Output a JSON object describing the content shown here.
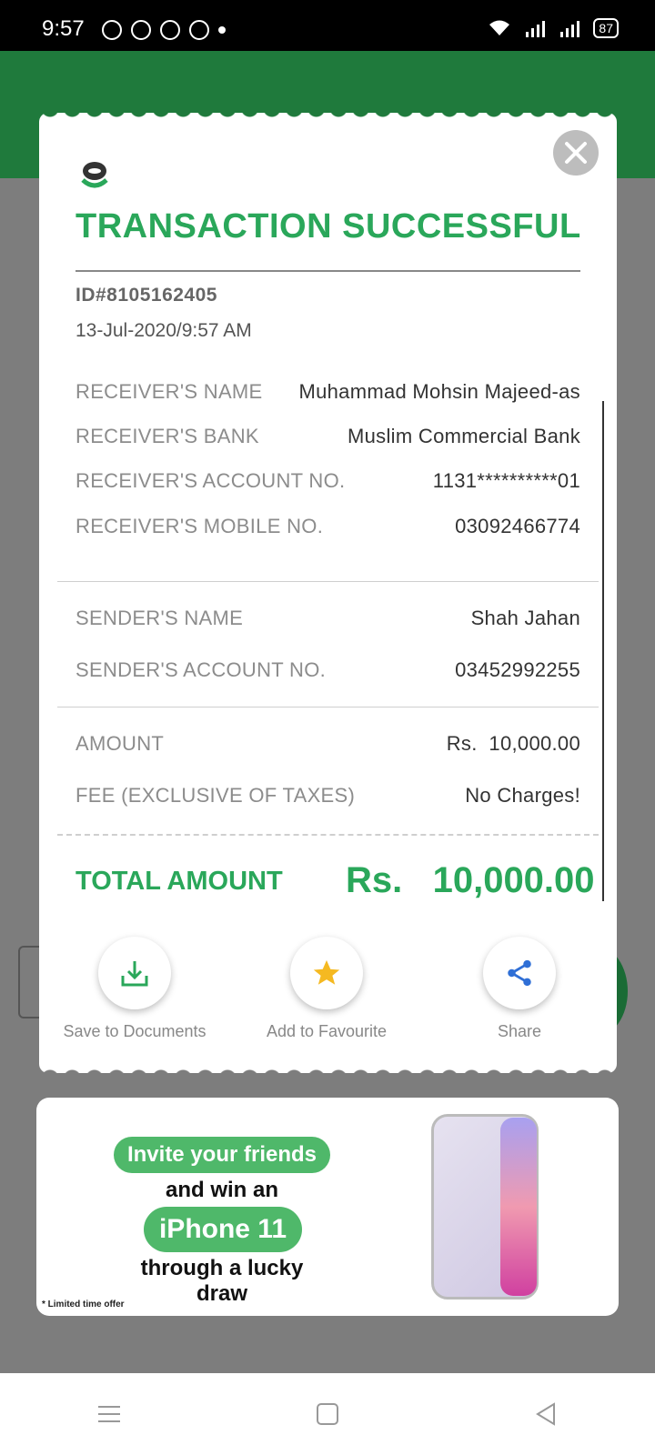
{
  "status_bar": {
    "time": "9:57",
    "battery": "87"
  },
  "dialog": {
    "title": "TRANSACTION SUCCESSFUL",
    "transaction_id": "ID#8105162405",
    "datetime": "13-Jul-2020/9:57 AM",
    "receiver": [
      {
        "label": "RECEIVER'S NAME",
        "value": "Muhammad Mohsin Majeed-as"
      },
      {
        "label": "RECEIVER'S BANK",
        "value": "Muslim Commercial Bank"
      },
      {
        "label": "RECEIVER'S ACCOUNT NO.",
        "value": "1131**********01"
      },
      {
        "label": "RECEIVER'S MOBILE NO.",
        "value": "03092466774"
      }
    ],
    "sender": [
      {
        "label": "SENDER'S NAME",
        "value": "Shah Jahan"
      },
      {
        "label": "SENDER'S ACCOUNT NO.",
        "value": "03452992255"
      }
    ],
    "charges": [
      {
        "label": "AMOUNT",
        "value": "Rs.  10,000.00"
      },
      {
        "label": "FEE (EXCLUSIVE OF TAXES)",
        "value": "No Charges!"
      }
    ],
    "total": {
      "label": "TOTAL AMOUNT",
      "value": "Rs.   10,000.00"
    },
    "actions": [
      {
        "label": "Save to Documents",
        "icon": "download-icon"
      },
      {
        "label": "Add to Favourite",
        "icon": "star-icon"
      },
      {
        "label": "Share",
        "icon": "share-icon"
      }
    ]
  },
  "banner": {
    "line1": "Invite your friends",
    "line2": "and win an",
    "line3": "iPhone 11",
    "line4": "through a lucky draw",
    "fine_print": "* Limited time offer"
  },
  "colors": {
    "accent_green": "#2aa75a",
    "header_green": "#1f7a3c",
    "overlay_gray": "#7d7d7d"
  }
}
